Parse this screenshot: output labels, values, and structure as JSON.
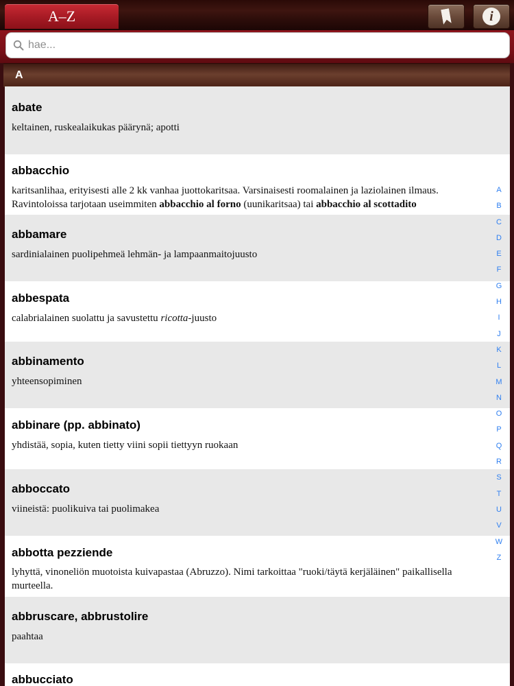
{
  "toolbar": {
    "az_tab": "A–Z",
    "bookmark_icon": "bookmark-icon",
    "info_icon": "info-icon",
    "info_glyph": "i"
  },
  "search": {
    "placeholder": "hae...",
    "value": ""
  },
  "section": {
    "letter": "A"
  },
  "entries": [
    {
      "term": "abate",
      "def": "keltainen, ruskealaikukas päärynä; apotti"
    },
    {
      "term": "abbacchio",
      "def_parts": [
        "karitsanlihaa, erityisesti alle 2 kk vanhaa juottokaritsaa. Varsinaisesti roomalainen ja laziolainen ilmaus. Ravintoloissa tarjotaan useimmiten ",
        "abbacchio al forno",
        " (uunikaritsaa) tai ",
        "abbacchio al scottadito"
      ]
    },
    {
      "term": "abbamare",
      "def": "sardinialainen puolipehmeä lehmän- ja lampaanmaitojuusto"
    },
    {
      "term": "abbespata",
      "def_parts": [
        "calabrialainen suolattu ja savustettu ",
        "ricotta",
        "-juusto"
      ]
    },
    {
      "term": "abbinamento",
      "def": "yhteensopiminen"
    },
    {
      "term": "abbinare (pp. abbinato)",
      "def": "yhdistää, sopia, kuten tietty viini sopii tiettyyn ruokaan"
    },
    {
      "term": "abboccato",
      "def": "viineistä: puolikuiva tai puolimakea"
    },
    {
      "term": "abbotta pezziende",
      "def": "lyhyttä, vinoneliön muotoista kuivapastaa (Abruzzo). Nimi tarkoittaa \"ruoki/täytä kerjäläinen\" paikallisella murteella."
    },
    {
      "term": "abbruscare, abbrustolire",
      "def": "paahtaa"
    },
    {
      "term": "abbucciato",
      "def": ""
    }
  ],
  "alphabet": [
    "A",
    "B",
    "C",
    "D",
    "E",
    "F",
    "G",
    "H",
    "I",
    "J",
    "K",
    "L",
    "M",
    "N",
    "O",
    "P",
    "Q",
    "R",
    "S",
    "T",
    "U",
    "V",
    "W",
    "Z"
  ],
  "colors": {
    "header_red": "#a51a24",
    "index_blue": "#2f7ff0",
    "row_shade": "#e8e8e8"
  }
}
